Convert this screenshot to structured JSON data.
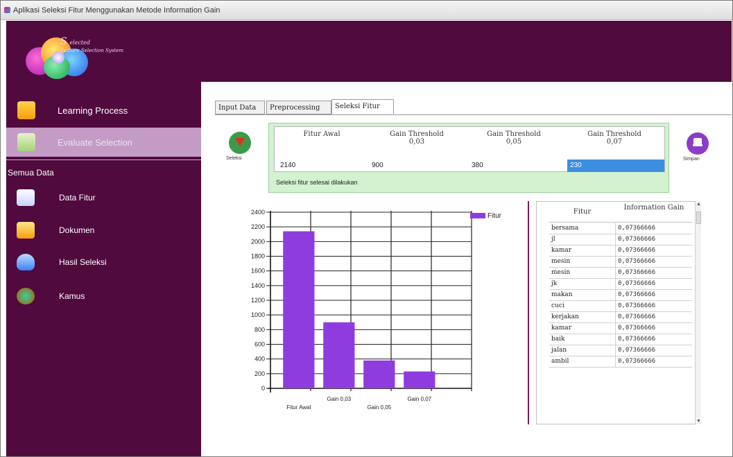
{
  "window": {
    "title": "Aplikasi Seleksi Fitur Menggunakan Metode Information Gain"
  },
  "logo": {
    "initial": "S",
    "name": "elected",
    "subtitle": "Feature Selection System"
  },
  "sidebar": {
    "nav": [
      {
        "label": "Learning Process",
        "icon": "notepad-icon"
      },
      {
        "label": "Evaluate Selection",
        "icon": "document-icon"
      }
    ],
    "section_title": "Semua Data",
    "items": [
      {
        "label": "Data Fitur",
        "icon": "papers-icon"
      },
      {
        "label": "Dokumen",
        "icon": "folder-icon"
      },
      {
        "label": "Hasil Seleksi",
        "icon": "funnel-icon"
      },
      {
        "label": "Kamus",
        "icon": "dictionary-icon"
      }
    ]
  },
  "tabs": [
    "Input Data",
    "Preprocessing",
    "Seleksi Fitur"
  ],
  "toolbar": {
    "process_label": "Seleksi",
    "export_label": "Simpan"
  },
  "threshold": {
    "headers": [
      {
        "line1": "Fitur Awal",
        "line2": ""
      },
      {
        "line1": "Gain Threshold",
        "line2": "0,03"
      },
      {
        "line1": "Gain Threshold",
        "line2": "0,05"
      },
      {
        "line1": "Gain Threshold",
        "line2": "0,07"
      }
    ],
    "values": [
      "2140",
      "900",
      "380",
      "230"
    ],
    "status": "Seleksi fitur selesai dilakukan"
  },
  "chart_data": {
    "type": "bar",
    "categories": [
      "Fitur Awal",
      "Gain 0,03",
      "Gain 0,05",
      "Gain 0,07"
    ],
    "series": [
      {
        "name": "Fitur",
        "values": [
          2140,
          900,
          380,
          230
        ]
      }
    ],
    "ylim": [
      0,
      2400
    ],
    "yticks": [
      0,
      200,
      400,
      600,
      800,
      1000,
      1200,
      1400,
      1600,
      1800,
      2000,
      2200,
      2400
    ],
    "grid": true,
    "legend": "top-right",
    "bar_color": "#8f3cdf"
  },
  "grid": {
    "headers": [
      "Fitur",
      "Information Gain"
    ],
    "rows": [
      {
        "fitur": "bersama",
        "gain": "0,07366666"
      },
      {
        "fitur": "jl",
        "gain": "0,07366666"
      },
      {
        "fitur": "kamar",
        "gain": "0,07366666"
      },
      {
        "fitur": "mesin",
        "gain": "0,07366666"
      },
      {
        "fitur": "mesin",
        "gain": "0,07366666"
      },
      {
        "fitur": "jk",
        "gain": "0,07366666"
      },
      {
        "fitur": "makan",
        "gain": "0,07366666"
      },
      {
        "fitur": "cuci",
        "gain": "0,07366666"
      },
      {
        "fitur": "kerjakan",
        "gain": "0,07366666"
      },
      {
        "fitur": "kamar",
        "gain": "0,07366666"
      },
      {
        "fitur": "baik",
        "gain": "0,07366666"
      },
      {
        "fitur": "jalan",
        "gain": "0,07366666"
      },
      {
        "fitur": "ambil",
        "gain": "0,07366666"
      }
    ]
  },
  "colors": {
    "sidebar": "#500a3e",
    "active_nav": "#c39bc4",
    "panel": "#d2f2d0",
    "selection": "#3d8ee0"
  }
}
